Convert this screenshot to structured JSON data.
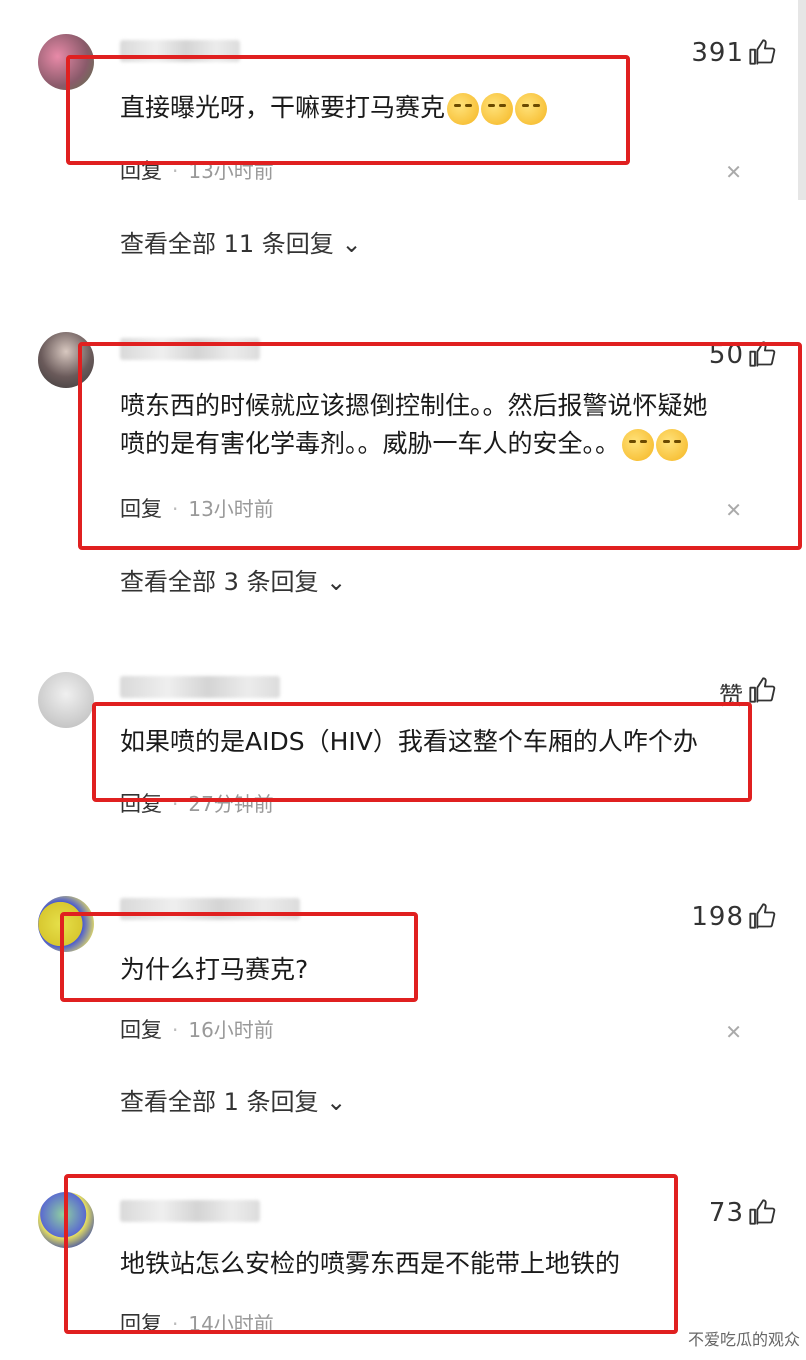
{
  "comments": [
    {
      "likes": "391",
      "text": "直接曝光呀，干嘛要打马赛克",
      "emoji_count": 3,
      "reply_label": "回复",
      "time": "13小时前",
      "view_all": "查看全部 11 条回复"
    },
    {
      "likes": "50",
      "text_line1": "喷东西的时候就应该摁倒控制住。。然后报警说怀疑她",
      "text_line2": "喷的是有害化学毒剂。。威胁一车人的安全。。",
      "emoji_count": 2,
      "reply_label": "回复",
      "time": "13小时前",
      "view_all": "查看全部 3 条回复"
    },
    {
      "likes": "赞",
      "text": "如果喷的是AIDS（HIV）我看这整个车厢的人咋个办",
      "reply_label": "回复",
      "time": "27分钟前"
    },
    {
      "likes": "198",
      "text": "为什么打马赛克?",
      "reply_label": "回复",
      "time": "16小时前",
      "view_all": "查看全部 1 条回复"
    },
    {
      "likes": "73",
      "text": "地铁站怎么安检的喷雾东西是不能带上地铁的",
      "reply_label": "回复",
      "time": "14小时前"
    }
  ],
  "icons": {
    "like": "thumbs-up-icon",
    "close": "close-icon",
    "chevron": "chevron-down-icon"
  },
  "colors": {
    "highlight_box": "#e02020",
    "meta": "#999999"
  },
  "watermark": "不爱吃瓜的观众"
}
